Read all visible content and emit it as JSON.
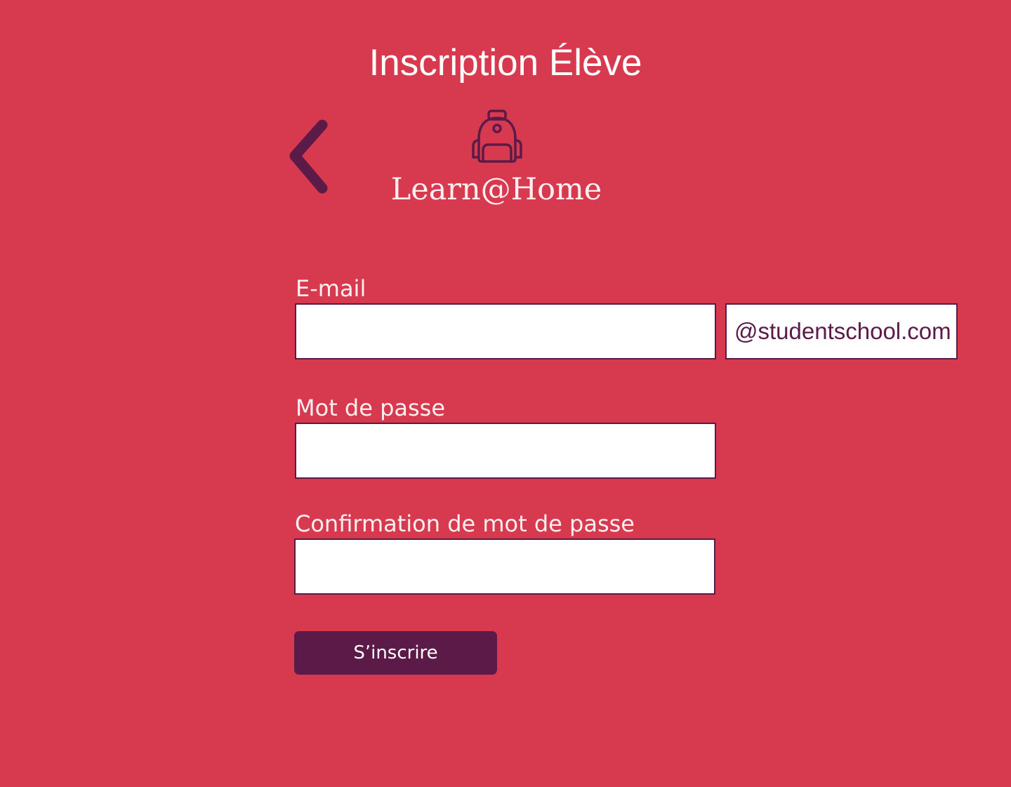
{
  "page": {
    "title": "Inscription Élève",
    "background_color": "#d73a4f",
    "accent_color": "#5c1a49"
  },
  "header": {
    "back_icon": "chevron-left-icon",
    "logo_icon": "backpack-icon",
    "brand_name": "Learn@Home"
  },
  "form": {
    "email": {
      "label": "E-mail",
      "value": "",
      "placeholder": "",
      "domain_suffix": "@studentschool.com"
    },
    "password": {
      "label": "Mot de passe",
      "value": "",
      "placeholder": ""
    },
    "password_confirm": {
      "label": "Confirmation de mot de passe",
      "value": "",
      "placeholder": ""
    },
    "submit_label": "S’inscrire"
  }
}
